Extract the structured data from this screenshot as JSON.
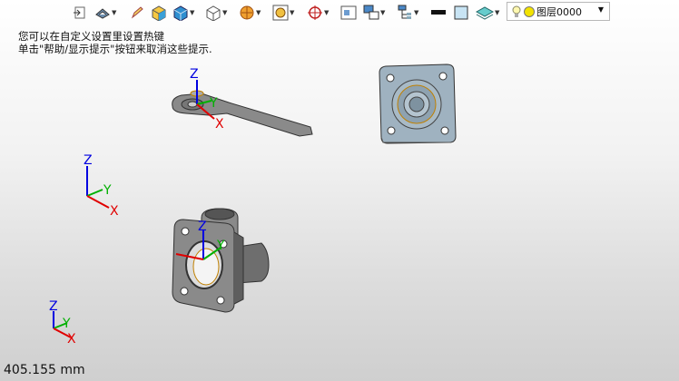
{
  "toolbar": {
    "items": [
      {
        "icon": "exit-icon"
      },
      {
        "icon": "view-icon"
      },
      {
        "icon": "pencil-icon"
      },
      {
        "icon": "shaded-cube-icon"
      },
      {
        "icon": "solid-cube-icon"
      },
      {
        "icon": "wireframe-cube-icon"
      },
      {
        "icon": "render-sphere-icon"
      },
      {
        "icon": "frame-icon"
      },
      {
        "icon": "target-icon"
      },
      {
        "icon": "window-icon"
      },
      {
        "icon": "layout-icon"
      },
      {
        "icon": "tree-icon"
      },
      {
        "icon": "line-weight-icon"
      },
      {
        "icon": "color-swatch-icon"
      },
      {
        "icon": "layers-icon"
      }
    ],
    "layer": {
      "name": "图层0000"
    }
  },
  "hint": {
    "line1": "您可以在自定义设置里设置热键",
    "line2": "单击\"帮助/显示提示\"按钮来取消这些提示."
  },
  "axes": {
    "x": "X",
    "y": "Y",
    "z": "Z"
  },
  "status": {
    "measurement": "405.155 mm"
  },
  "colors": {
    "x_axis": "#e00000",
    "y_axis": "#00b000",
    "z_axis": "#0000e0",
    "part_fill": "#8a8a8a",
    "flange_fill": "#9fb2c0"
  }
}
